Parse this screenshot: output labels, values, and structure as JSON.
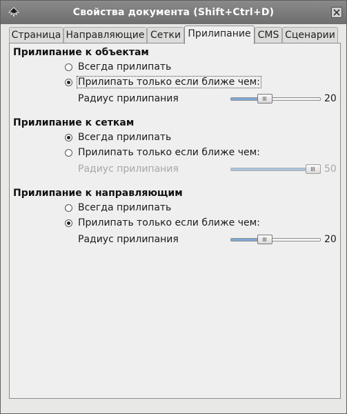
{
  "window": {
    "title": "Свойства документа (Shift+Ctrl+D)",
    "app_icon": "inkscape-icon",
    "close_icon": "close-icon"
  },
  "tabs": [
    {
      "label": "Страница",
      "active": false
    },
    {
      "label": "Направляющие",
      "active": false
    },
    {
      "label": "Сетки",
      "active": false
    },
    {
      "label": "Прилипание",
      "active": true
    },
    {
      "label": "CMS",
      "active": false
    },
    {
      "label": "Сценарии",
      "active": false
    }
  ],
  "sections": [
    {
      "title": "Прилипание к объектам",
      "option_always": "Всегда прилипать",
      "option_near": "Прилипать только если ближе чем:",
      "selected": "near",
      "radius_label": "Радиус прилипания",
      "radius_value": "20",
      "radius_fraction": 0.36,
      "enabled": true
    },
    {
      "title": "Прилипание к сеткам",
      "option_always": "Всегда прилипать",
      "option_near": "Прилипать только если ближе чем:",
      "selected": "always",
      "radius_label": "Радиус прилипания",
      "radius_value": "50",
      "radius_fraction": 1.0,
      "enabled": false
    },
    {
      "title": "Прилипание к направляющим",
      "option_always": "Всегда прилипать",
      "option_near": "Прилипать только если ближе чем:",
      "selected": "near",
      "radius_label": "Радиус прилипания",
      "radius_value": "20",
      "radius_fraction": 0.36,
      "enabled": true
    }
  ]
}
